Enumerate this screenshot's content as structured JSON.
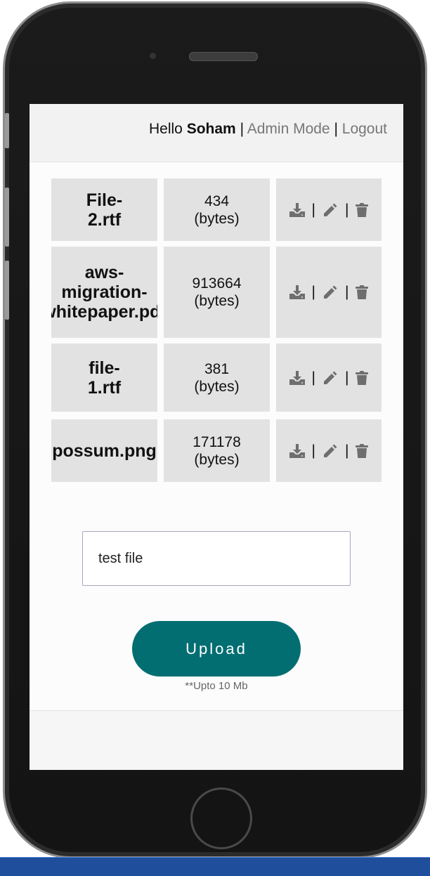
{
  "header": {
    "greeting": "Hello",
    "user_name": "Soham",
    "separator": "|",
    "admin_mode_label": "Admin Mode",
    "logout_label": "Logout"
  },
  "files": [
    {
      "name_lines": [
        "File-",
        "2.rtf"
      ],
      "size": "434",
      "unit": "(bytes)"
    },
    {
      "name_lines": [
        "aws-",
        "migration-",
        "whitepaper.pdf"
      ],
      "size": "913664",
      "unit": "(bytes)"
    },
    {
      "name_lines": [
        "file-",
        "1.rtf"
      ],
      "size": "381",
      "unit": "(bytes)"
    },
    {
      "name_lines": [
        "possum.png"
      ],
      "size": "171178",
      "unit": "(bytes)"
    }
  ],
  "actions": {
    "separator": "|",
    "download_icon": "download-icon",
    "edit_icon": "pencil-icon",
    "delete_icon": "trash-icon"
  },
  "upload": {
    "input_value": "test file",
    "button_label": "Upload",
    "note": "**Upto 10 Mb"
  },
  "colors": {
    "upload_button": "#036e72",
    "link": "#777777",
    "cell_background": "#e2e2e2",
    "icon": "#6e6e6e",
    "taskbar": "#1f4e9c"
  }
}
